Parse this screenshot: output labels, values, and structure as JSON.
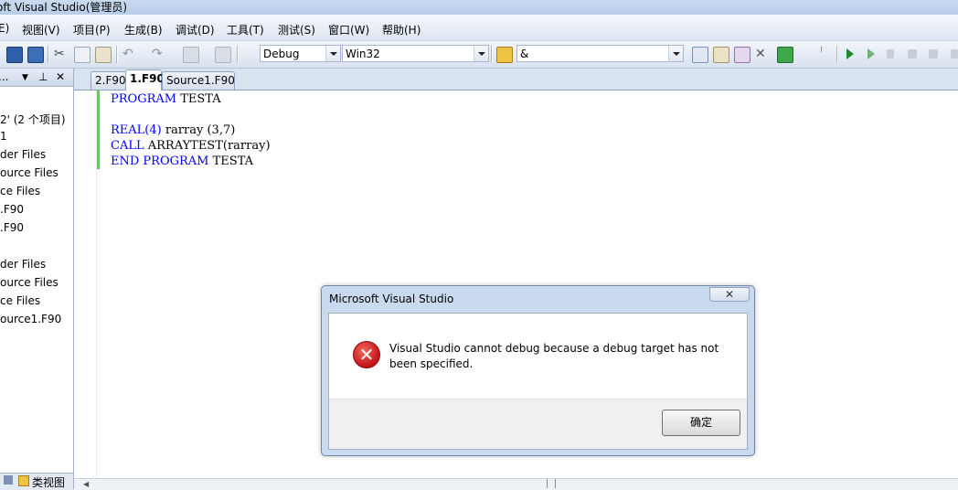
{
  "window": {
    "title": "oft Visual Studio(管理员)"
  },
  "menu": [
    "E)",
    "视图(V)",
    "项目(P)",
    "生成(B)",
    "调试(D)",
    "工具(T)",
    "测试(S)",
    "窗口(W)",
    "帮助(H)"
  ],
  "toolbar": {
    "config_value": "Debug",
    "platform_value": "Win32",
    "find_value": "&"
  },
  "solution_panel": {
    "header_text": "...",
    "tree_items": [
      "2' (2 个项目)",
      "1",
      "der Files",
      "ource Files",
      "ce Files",
      ".F90",
      ".F90",
      "",
      "der Files",
      "ource Files",
      "ce Files",
      "ource1.F90"
    ],
    "bottom_tab": "类视图"
  },
  "editor": {
    "tabs": [
      "2.F90",
      "1.F90",
      "Source1.F90"
    ],
    "active_tab": "1.F90",
    "code": {
      "line1_kw": "PROGRAM",
      "line1_rest": " TESTA",
      "line3_kw": "REAL(4)",
      "line3_rest": " rarray (3,7)",
      "line4_kw": "CALL",
      "line4_rest": " ARRAYTEST(rarray)",
      "line5_kw": "END PROGRAM",
      "line5_rest": " TESTA"
    }
  },
  "dialog": {
    "title": "Microsoft Visual Studio",
    "close_label": "✕",
    "message": "Visual Studio cannot debug because a debug target has not been specified.",
    "ok_label": "确定",
    "icon": "error-icon"
  }
}
